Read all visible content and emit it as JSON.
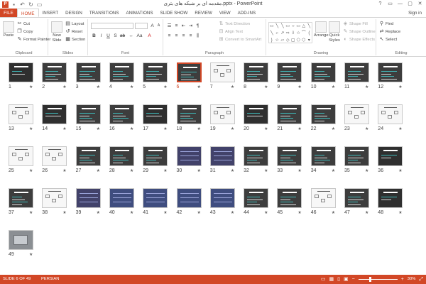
{
  "window": {
    "title": "مقدمه ای بر شبکه های بتری.pptx - PowerPoint",
    "controls": [
      "?",
      "▭",
      "—",
      "▢",
      "✕"
    ]
  },
  "quick_access": {
    "icons": [
      "save-icon",
      "undo-icon",
      "redo-icon",
      "slideshow-start-icon"
    ]
  },
  "tabs": {
    "file": "FILE",
    "items": [
      "HOME",
      "INSERT",
      "DESIGN",
      "TRANSITIONS",
      "ANIMATIONS",
      "SLIDE SHOW",
      "REVIEW",
      "VIEW",
      "ADD-INS"
    ],
    "active": "HOME",
    "signin": "Sign in"
  },
  "ribbon": {
    "clipboard": {
      "label": "Clipboard",
      "paste": "Paste",
      "cut": "Cut",
      "copy": "Copy",
      "format_painter": "Format Painter"
    },
    "slides": {
      "label": "Slides",
      "new_slide_1": "New",
      "new_slide_2": "Slide",
      "layout": "Layout",
      "reset": "Reset",
      "section": "Section"
    },
    "font": {
      "label": "Font",
      "size": ""
    },
    "paragraph": {
      "label": "Paragraph",
      "text_direction": "Text Direction",
      "align_text": "Align Text",
      "convert_smartart": "Convert to SmartArt"
    },
    "drawing": {
      "label": "Drawing",
      "arrange": "Arrange",
      "quick_styles_1": "Quick",
      "quick_styles_2": "Styles",
      "shape_fill": "Shape Fill",
      "shape_outline": "Shape Outline",
      "shape_effects": "Shape Effects"
    },
    "editing": {
      "label": "Editing",
      "find": "Find",
      "replace": "Replace",
      "select": "Select"
    }
  },
  "slides": [
    {
      "num": "1",
      "style": "title"
    },
    {
      "num": "2",
      "style": "dark"
    },
    {
      "num": "3",
      "style": "dark"
    },
    {
      "num": "4",
      "style": "dark"
    },
    {
      "num": "5",
      "style": "dark"
    },
    {
      "num": "6",
      "style": "dark-selected"
    },
    {
      "num": "7",
      "style": "white"
    },
    {
      "num": "8",
      "style": "dark"
    },
    {
      "num": "9",
      "style": "dark"
    },
    {
      "num": "10",
      "style": "dark"
    },
    {
      "num": "11",
      "style": "dark"
    },
    {
      "num": "12",
      "style": "dark"
    },
    {
      "num": "13",
      "style": "white"
    },
    {
      "num": "14",
      "style": "title"
    },
    {
      "num": "15",
      "style": "dark"
    },
    {
      "num": "16",
      "style": "dark"
    },
    {
      "num": "17",
      "style": "title"
    },
    {
      "num": "18",
      "style": "dark"
    },
    {
      "num": "19",
      "style": "white"
    },
    {
      "num": "20",
      "style": "title"
    },
    {
      "num": "21",
      "style": "dark"
    },
    {
      "num": "22",
      "style": "dark"
    },
    {
      "num": "23",
      "style": "white"
    },
    {
      "num": "24",
      "style": "white"
    },
    {
      "num": "25",
      "style": "white"
    },
    {
      "num": "26",
      "style": "white"
    },
    {
      "num": "27",
      "style": "dark"
    },
    {
      "num": "28",
      "style": "dark"
    },
    {
      "num": "29",
      "style": "dark"
    },
    {
      "num": "30",
      "style": "purple"
    },
    {
      "num": "31",
      "style": "purple"
    },
    {
      "num": "32",
      "style": "dark"
    },
    {
      "num": "33",
      "style": "dark"
    },
    {
      "num": "34",
      "style": "dark"
    },
    {
      "num": "35",
      "style": "dark"
    },
    {
      "num": "36",
      "style": "title"
    },
    {
      "num": "37",
      "style": "dark"
    },
    {
      "num": "38",
      "style": "white"
    },
    {
      "num": "39",
      "style": "purple"
    },
    {
      "num": "40",
      "style": "blue"
    },
    {
      "num": "41",
      "style": "blue"
    },
    {
      "num": "42",
      "style": "blue"
    },
    {
      "num": "43",
      "style": "blue"
    },
    {
      "num": "44",
      "style": "dark"
    },
    {
      "num": "45",
      "style": "dark"
    },
    {
      "num": "46",
      "style": "white"
    },
    {
      "num": "47",
      "style": "dark"
    },
    {
      "num": "48",
      "style": "title"
    },
    {
      "num": "49",
      "style": "photo"
    }
  ],
  "status": {
    "slide_info": "SLIDE 6 OF 49",
    "language": "PERSIAN",
    "zoom_percent": "30%",
    "zoom_level": 0.3
  },
  "colors": {
    "accent": "#d24726",
    "dark_slide": "#3d3d3d",
    "teal_text": "#3fb8b8"
  }
}
